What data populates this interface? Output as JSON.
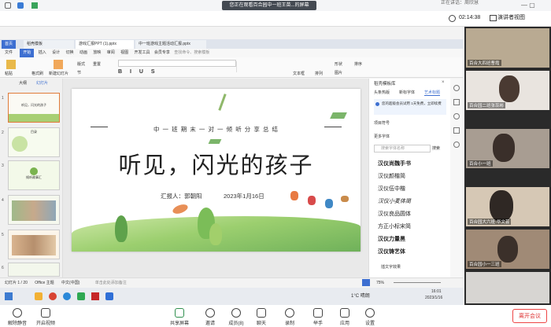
{
  "banner": "您正在观看百合园中一班王苗...的屏幕",
  "speaker": "正在讲话：周欣慧",
  "timer": "02:14:38",
  "gallery_label": "演讲者视图",
  "tabs": [
    "首页",
    "稻壳模板",
    "游戏汇报PPT (1).pptx",
    "中一班游戏主题活动汇报.pptx"
  ],
  "menu": [
    "文件",
    "开始",
    "插入",
    "设计",
    "切换",
    "动画",
    "放映",
    "审阅",
    "视图",
    "开发工具",
    "会员专享",
    "查找命令、搜索模板"
  ],
  "ribbon": {
    "paste": "粘贴",
    "format": "格式刷",
    "slide": "新建幻灯片",
    "layout": "版式",
    "section": "节",
    "reset": "重置",
    "textbox": "文本框",
    "arrange": "排列",
    "shape": "形状",
    "pic": "图片",
    "sort": "排序"
  },
  "thumb_header": {
    "outline": "大纲",
    "slides": "幻灯片"
  },
  "slide": {
    "top_title": "中 一 班 期 末 一 对 一 倾 听 分 享 总 结",
    "main_title": "听见，闪光的孩子",
    "reporter": "汇报人：郭朝阳",
    "date": "2023年1月16日"
  },
  "thumbs": [
    {
      "n": "1",
      "t": "听见，闪光的孩子"
    },
    {
      "n": "2",
      "t": "目录"
    },
    {
      "n": "3",
      "t": "倾听故事汇"
    },
    {
      "n": "4",
      "t": ""
    },
    {
      "n": "5",
      "t": ""
    },
    {
      "n": "6",
      "t": ""
    }
  ],
  "pane": {
    "title": "稻壳模板库",
    "tabs": [
      "头条热版",
      "新标字体",
      "艺术标题"
    ],
    "notice": "您的超级会员试用 1天免费，立即续费",
    "section1": "项目符号",
    "section2": "更多字体",
    "search": "搜索字体名称",
    "search_btn": "搜索",
    "fonts": [
      "汉仪尚魏手书",
      "汉仪颜楷简",
      "汉仪伍中楷",
      "汉仪小麦体简",
      "汉仪良品圆体",
      "方正小标宋简",
      "汉仪力量黑",
      "汉仪铸艺体"
    ],
    "footer": "插文字效果"
  },
  "status": {
    "slide": "幻灯片 1 / 20",
    "theme": "Office 主题",
    "lang": "中文(中国)",
    "notes": "单击此处添加备注",
    "zoom": "75%"
  },
  "taskbar": {
    "weather": "1°C 晴朗",
    "time": "16:01",
    "date": "2023/1/16"
  },
  "bottom": {
    "mute": "解除静音",
    "video": "开启视频",
    "share": "共享屏幕",
    "invite": "邀请",
    "members": "成员(8)",
    "chat": "聊天",
    "record": "录制",
    "hand": "举手",
    "apps": "应用",
    "settings": "设置",
    "leave": "离开会议"
  },
  "videos": [
    {
      "name": "百合大四班曹霞",
      "bg": "#b9aa92"
    },
    {
      "name": "百合园二班张蕊彬",
      "bg": "#e9e4df"
    },
    {
      "name": "百合小一班",
      "bg": "#a89d92"
    },
    {
      "name": "百合园大六班·华文芸",
      "bg": "#d6c8b5"
    },
    {
      "name": "百合园小一三班",
      "bg": "#a08a76"
    },
    {
      "name": "",
      "bg": "#d7d5d2"
    }
  ]
}
